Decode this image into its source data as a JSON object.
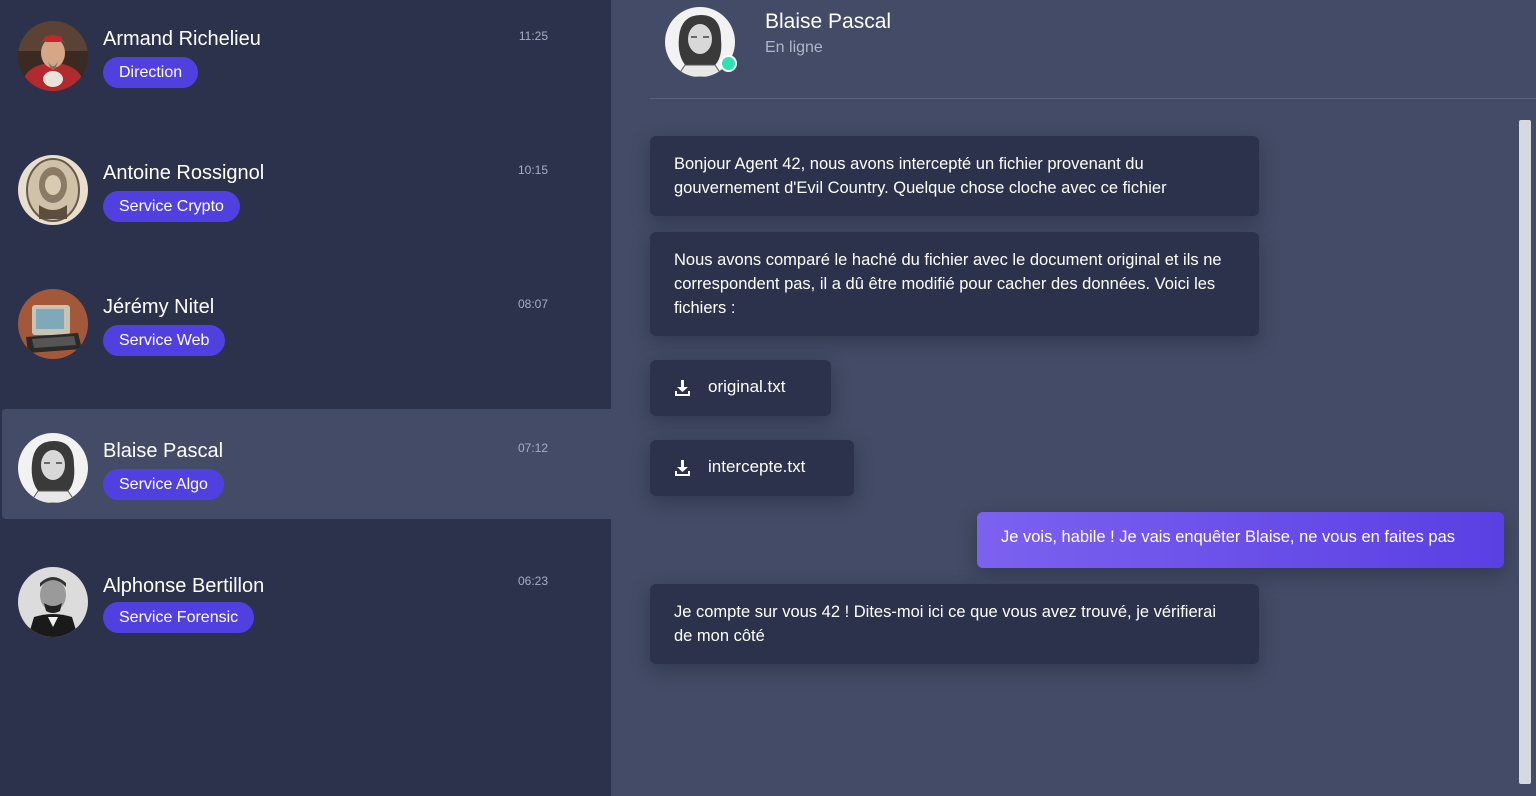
{
  "contacts": [
    {
      "name": "Armand Richelieu",
      "badge": "Direction",
      "time": "11:25"
    },
    {
      "name": "Antoine Rossignol",
      "badge": "Service Crypto",
      "time": "10:15"
    },
    {
      "name": "Jérémy Nitel",
      "badge": "Service Web",
      "time": "08:07"
    },
    {
      "name": "Blaise Pascal",
      "badge": "Service Algo",
      "time": "07:12",
      "active": true
    },
    {
      "name": "Alphonse Bertillon",
      "badge": "Service Forensic",
      "time": "06:23"
    }
  ],
  "chat": {
    "name": "Blaise Pascal",
    "status": "En ligne",
    "messages": [
      "Bonjour Agent 42, nous avons intercepté un fichier provenant du gouvernement d'Evil Country. Quelque chose cloche avec ce fichier",
      "Nous avons comparé le haché du fichier avec le document original et ils ne correspondent pas, il a dû être modifié pour cacher des données. Voici les fichiers :",
      "Je compte sur vous 42 ! Dites-moi ici ce que vous avez trouvé, je vérifierai de mon côté"
    ],
    "files": [
      "original.txt",
      "intercepte.txt"
    ],
    "reply": "Je vois, habile ! Je vais enquêter Blaise, ne vous en faites pas"
  },
  "colors": {
    "sidebar": "#2c324b",
    "main": "#434b66",
    "badge": "#5140e0",
    "online": "#2fe0b5",
    "outgoing": "#6a50ea"
  },
  "icons": {
    "download": "download-icon",
    "online": "online-status-icon"
  }
}
